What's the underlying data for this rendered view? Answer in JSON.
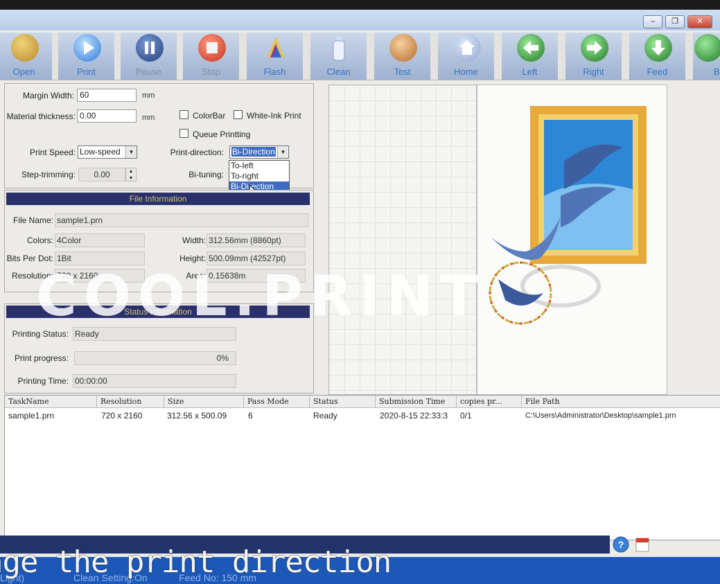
{
  "window": {
    "minimize": "–",
    "restore": "❐",
    "close": "✕"
  },
  "toolbar": [
    {
      "label": "Open",
      "icon": "folder-icon",
      "color": "#c9a03c"
    },
    {
      "label": "Print",
      "icon": "play-icon",
      "color": "#3f8de6"
    },
    {
      "label": "Pause",
      "icon": "pause-icon",
      "color": "#2b4f8f"
    },
    {
      "label": "Stop",
      "icon": "stop-icon",
      "color": "#e0402a"
    },
    {
      "label": "Flash",
      "icon": "pen-icon",
      "color": "#b04a9a"
    },
    {
      "label": "Clean",
      "icon": "bottle-icon",
      "color": "#9ab4dc"
    },
    {
      "label": "Test",
      "icon": "paper-icon",
      "color": "#d27030"
    },
    {
      "label": "Home",
      "icon": "house-icon",
      "color": "#8fa8d4"
    },
    {
      "label": "Left",
      "icon": "arrow-left-icon",
      "color": "#2f8a2f"
    },
    {
      "label": "Right",
      "icon": "arrow-right-icon",
      "color": "#2f8a2f"
    },
    {
      "label": "Feed",
      "icon": "arrow-down-icon",
      "color": "#2f8a2f"
    },
    {
      "label": "B",
      "icon": "arrow-up-icon",
      "color": "#2f8a2f"
    }
  ],
  "settings": {
    "margin_width_label": "Margin Width:",
    "margin_width_value": "60",
    "margin_unit": "mm",
    "thickness_label": "Material thickness:",
    "thickness_value": "0.00",
    "thickness_unit": "mm",
    "colorbar": "ColorBar",
    "white_ink": "White-Ink Print",
    "queue": "Queue Printting",
    "speed_label": "Print Speed:",
    "speed_value": "Low-speed",
    "direction_label": "Print-direction:",
    "direction_value": "Bi-Direction",
    "direction_options": [
      "To-left",
      "To-right",
      "Bi-Direction"
    ],
    "step_label": "Step-trimming:",
    "step_value": "0.00",
    "bituning_label": "Bi-tuning:"
  },
  "file_info": {
    "header": "File Information",
    "name_label": "File Name:",
    "name": "sample1.prn",
    "colors_label": "Colors:",
    "colors": "4Color",
    "width_label": "Width:",
    "width": "312.56mm (8860pt)",
    "bits_label": "Bits Per Dot:",
    "bits": "1Bit",
    "height_label": "Height:",
    "height": "500.09mm (42527pt)",
    "resolution_label": "Resolution:",
    "resolution": "720 x 2160",
    "area_label": "Area:",
    "area": "0.15638m"
  },
  "status_info": {
    "header": "Status Information",
    "status_label": "Printing Status:",
    "status": "Ready",
    "progress_label": "Print progress:",
    "progress_text": "0%",
    "progress": 0,
    "time_label": "Printing Time:",
    "time": "00:00:00"
  },
  "table": {
    "columns": [
      "TaskName",
      "Resolution",
      "Size",
      "Pass Mode",
      "Status",
      "Submission Time",
      "copies pr...",
      "File Path"
    ],
    "rows": [
      [
        "sample1.prn",
        "720 x 2160",
        "312.56 x 500.09",
        "6",
        "Ready",
        "2020-8-15 22:33:3",
        "0/1",
        "C:\\Users\\Administrator\\Desktop\\sample1.prn"
      ]
    ]
  },
  "bottom": {
    "left_text": "Light)",
    "mid_text": "Clean Setting:On",
    "right_text": "Feed No: 150 mm"
  },
  "caption": "nge the print direction",
  "watermark": "COOL.PRINT",
  "colors": {
    "accent": "#3d6cc3",
    "header_bar": "#29306b",
    "header_text": "#d7c67a"
  }
}
